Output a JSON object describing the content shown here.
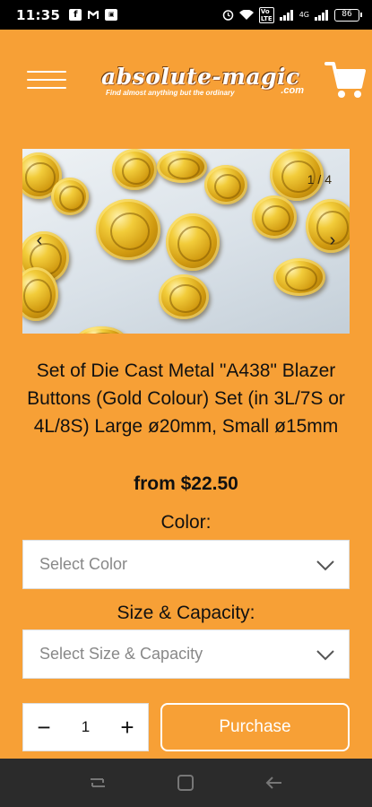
{
  "status_bar": {
    "time": "11:35",
    "left_icons": [
      "facebook-icon",
      "gmail-icon",
      "gallery-icon"
    ],
    "network_text": "4G",
    "battery": "86"
  },
  "header": {
    "logo_text": "absolute-magic",
    "logo_tagline": "Find almost anything but the ordinary",
    "logo_domain": ".com",
    "menu_icon": "hamburger-icon",
    "cart_icon": "cart-icon"
  },
  "gallery": {
    "counter": "1 / 4",
    "prev_icon": "chevron-left-icon",
    "next_icon": "chevron-right-icon"
  },
  "product": {
    "title": "Set of Die Cast Metal \"A438\" Blazer Buttons (Gold Colour) Set (in 3L/7S or 4L/8S) Large ø20mm, Small ø15mm",
    "price": "from $22.50"
  },
  "options": {
    "color_label": "Color:",
    "color_placeholder": "Select Color",
    "size_label": "Size & Capacity:",
    "size_placeholder": "Select Size & Capacity"
  },
  "purchase": {
    "quantity": "1",
    "minus": "−",
    "plus": "+",
    "button_label": "Purchase"
  },
  "nav_bar": {
    "recents_icon": "recents-icon",
    "home_icon": "home-icon",
    "back_icon": "back-icon"
  },
  "colors": {
    "background": "#f7a036",
    "white": "#ffffff",
    "text": "#111111"
  }
}
